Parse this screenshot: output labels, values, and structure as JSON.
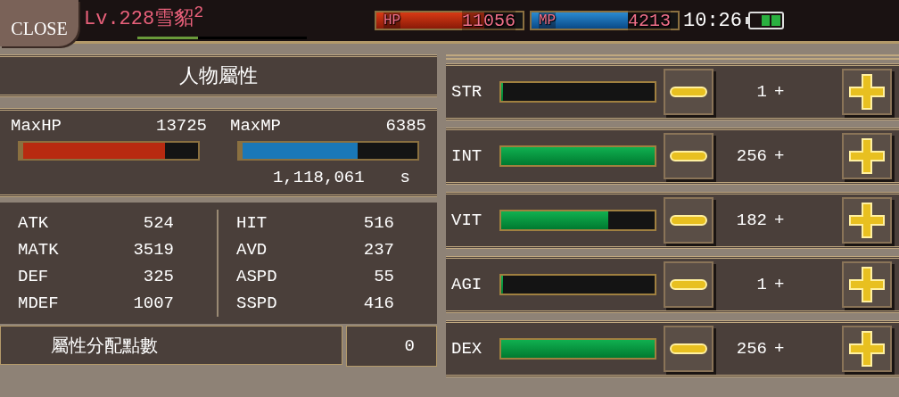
{
  "top_bar": {
    "close": "CLOSE",
    "level_name": "Lv.228雪貂",
    "name_suffix": "2",
    "exp": {
      "level": 0.36
    },
    "hp": {
      "label": "HP",
      "value": "11056",
      "level": 0.74
    },
    "mp": {
      "label": "MP",
      "value": "4213",
      "level": 0.66
    },
    "time": "10:26"
  },
  "profile": {
    "title": "人物屬性",
    "max": [
      {
        "label": "MaxHP",
        "value": "13725",
        "level": 0.81,
        "color": "#b82a10"
      },
      {
        "label": "MaxMP",
        "value": "6385",
        "level": 0.66,
        "color": "#1a78b8"
      }
    ],
    "exp": "1,118,061",
    "exp_unit": "s",
    "stats": [
      {
        "label": "ATK",
        "value": "524"
      },
      {
        "label": "HIT",
        "value": "516"
      },
      {
        "label": "MATK",
        "value": "3519"
      },
      {
        "label": "AVD",
        "value": "237"
      },
      {
        "label": "DEF",
        "value": "325"
      },
      {
        "label": "ASPD",
        "value": "55"
      },
      {
        "label": "MDEF",
        "value": "1007"
      },
      {
        "label": "SSPD",
        "value": "416"
      }
    ],
    "points_label": "屬性分配點數",
    "points": "0"
  },
  "attributes": [
    {
      "label": "STR",
      "level": 0,
      "value": "1",
      "plus": "+"
    },
    {
      "label": "INT",
      "level": 1,
      "value": "256",
      "plus": "+"
    },
    {
      "label": "VIT",
      "level": 0.7,
      "value": "182",
      "plus": "+"
    },
    {
      "label": "AGI",
      "level": 0,
      "value": "1",
      "plus": "+"
    },
    {
      "label": "DEX",
      "level": 1,
      "value": "256",
      "plus": "+"
    }
  ]
}
